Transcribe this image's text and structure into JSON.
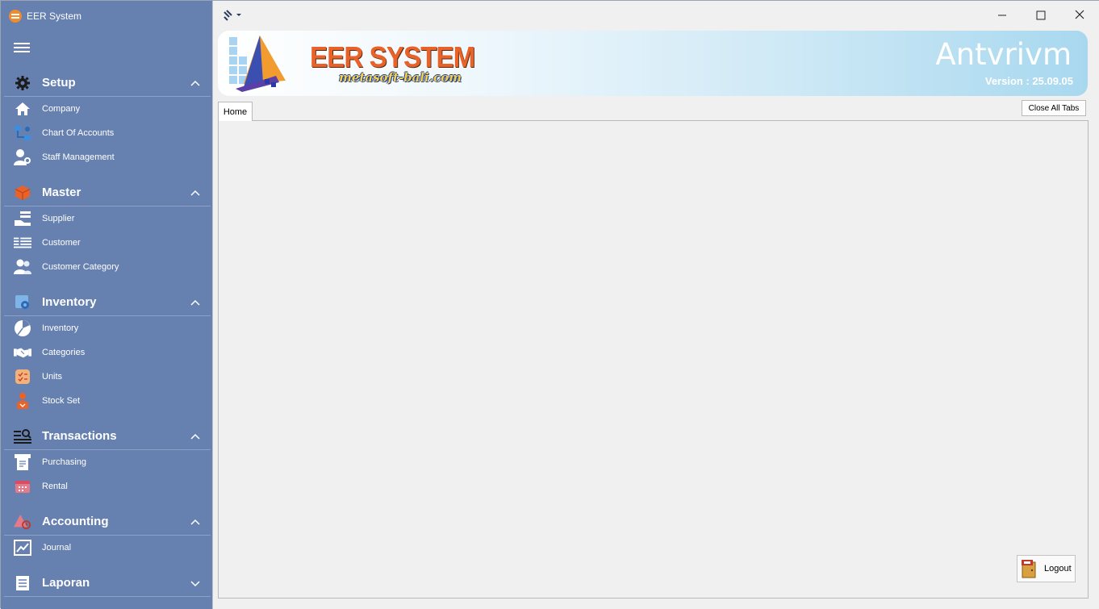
{
  "window": {
    "title": "EER System"
  },
  "sidebar": {
    "sections": [
      {
        "label": "Setup",
        "icon": "gear-icon",
        "items": [
          {
            "label": "Company",
            "icon": "home-icon"
          },
          {
            "label": "Chart Of Accounts",
            "icon": "chart-of-accounts-icon"
          },
          {
            "label": "Staff Management",
            "icon": "staff-icon"
          }
        ]
      },
      {
        "label": "Master",
        "icon": "box-icon",
        "items": [
          {
            "label": "Supplier",
            "icon": "supplier-icon"
          },
          {
            "label": "Customer",
            "icon": "customer-list-icon"
          },
          {
            "label": "Customer Category",
            "icon": "customer-category-icon"
          }
        ]
      },
      {
        "label": "Inventory",
        "icon": "inventory-settings-icon",
        "items": [
          {
            "label": "Inventory",
            "icon": "pie-icon"
          },
          {
            "label": "Categories",
            "icon": "handshake-icon"
          },
          {
            "label": "Units",
            "icon": "units-icon"
          },
          {
            "label": "Stock Set",
            "icon": "stock-set-icon"
          }
        ]
      },
      {
        "label": "Transactions",
        "icon": "transactions-icon",
        "items": [
          {
            "label": "Purchasing",
            "icon": "purchasing-icon"
          },
          {
            "label": "Rental",
            "icon": "calendar-icon"
          }
        ]
      },
      {
        "label": "Accounting",
        "icon": "accounting-icon",
        "items": [
          {
            "label": "Journal",
            "icon": "trend-icon"
          }
        ]
      },
      {
        "label": "Laporan",
        "icon": "report-icon",
        "items": []
      }
    ]
  },
  "banner": {
    "brand_title": "EER SYSTEM",
    "brand_subtitle": "metasoft-bali.com",
    "company_name": "Antvrivm",
    "version": "Version : 25.09.05"
  },
  "tabs": [
    {
      "label": "Home"
    }
  ],
  "close_all_label": "Close All Tabs",
  "logout_label": "Logout",
  "colors": {
    "sidebar_bg": "#6680b0",
    "accent_orange": "#e8622a"
  }
}
